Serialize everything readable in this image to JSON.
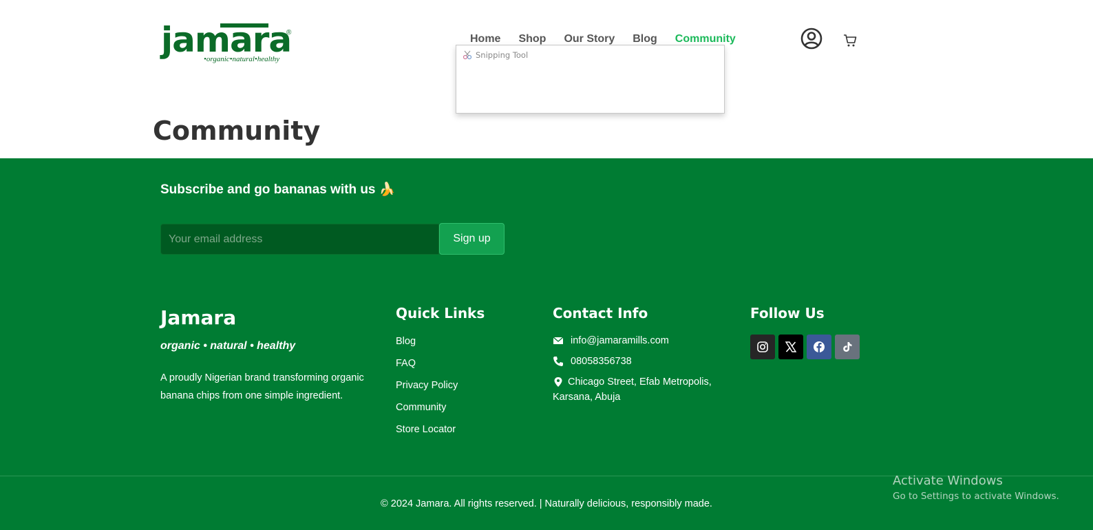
{
  "header": {
    "logo": {
      "wordmark": "jamara",
      "tagline": "•organic•natural•healthy",
      "registered": "®"
    },
    "nav": [
      {
        "label": "Home",
        "active": false
      },
      {
        "label": "Shop",
        "active": false
      },
      {
        "label": "Our Story",
        "active": false
      },
      {
        "label": "Blog",
        "active": false
      },
      {
        "label": "Community",
        "active": true
      }
    ],
    "icons": {
      "account": "user-circle-icon",
      "cart": "cart-icon"
    }
  },
  "snipping_tool": {
    "title": "Snipping Tool"
  },
  "page": {
    "title": "Community"
  },
  "footer": {
    "subscribe": {
      "title": "Subscribe and go bananas with us 🍌",
      "email_placeholder": "Your email address",
      "button_label": "Sign up"
    },
    "brand": {
      "name": "Jamara",
      "tagline": "organic • natural • healthy",
      "description": "A proudly Nigerian brand transforming organic banana chips from one simple ingredient."
    },
    "quick_links": {
      "heading": "Quick Links",
      "items": [
        "Blog",
        "FAQ",
        "Privacy Policy",
        "Community",
        "Store Locator"
      ]
    },
    "contact": {
      "heading": "Contact Info",
      "email": "info@jamaramills.com",
      "phone": "08058356738",
      "address": "Chicago Street, Efab Metropolis, Karsana, Abuja"
    },
    "follow": {
      "heading": "Follow Us",
      "networks": [
        "instagram-icon",
        "x-icon",
        "facebook-icon",
        "tiktok-icon"
      ]
    },
    "copyright": "© 2024 Jamara. All rights reserved. | Naturally delicious, responsibly made."
  },
  "windows_watermark": {
    "line1": "Activate Windows",
    "line2": "Go to Settings to activate Windows."
  },
  "colors": {
    "brand_green": "#0b6b28",
    "footer_bg": "#007c33",
    "nav_active": "#1bb95a",
    "button": "#13a150"
  }
}
